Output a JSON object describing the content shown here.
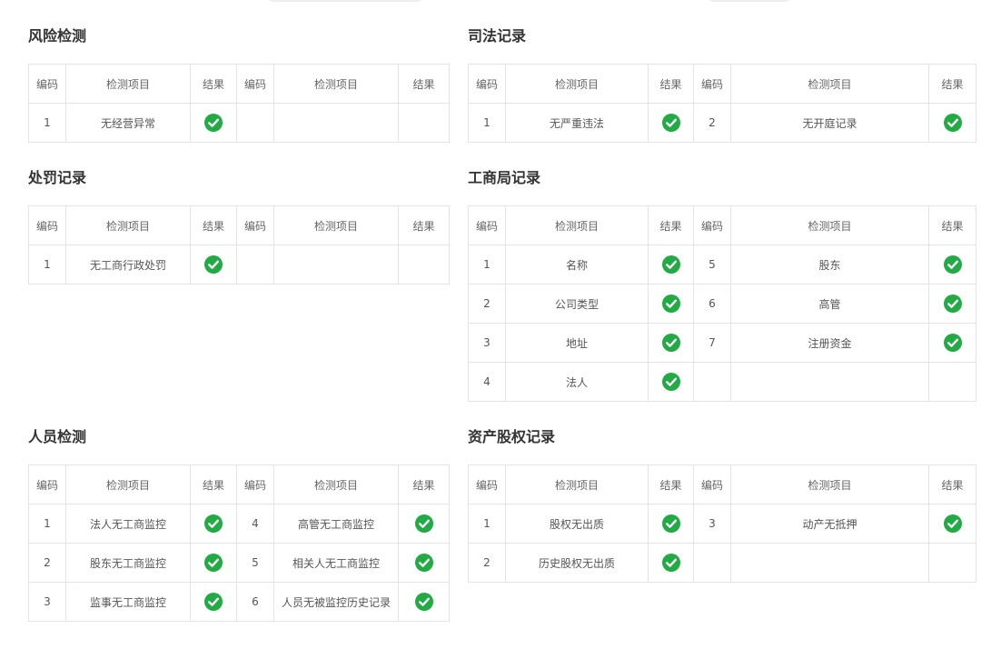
{
  "headers": {
    "code": "编码",
    "item": "检测项目",
    "result": "结果"
  },
  "colors": {
    "check": "#22aa44",
    "border": "#e4e4e4"
  },
  "icons": {
    "pass": "check-circle-icon"
  },
  "sections": [
    {
      "key": "risk",
      "title": "风险检测",
      "rows": [
        {
          "left": {
            "code": "1",
            "item": "无经营异常",
            "pass": true
          },
          "right": null
        }
      ]
    },
    {
      "key": "judicial",
      "title": "司法记录",
      "rows": [
        {
          "left": {
            "code": "1",
            "item": "无严重违法",
            "pass": true
          },
          "right": {
            "code": "2",
            "item": "无开庭记录",
            "pass": true
          }
        }
      ]
    },
    {
      "key": "penalty",
      "title": "处罚记录",
      "rows": [
        {
          "left": {
            "code": "1",
            "item": "无工商行政处罚",
            "pass": true
          },
          "right": null
        }
      ]
    },
    {
      "key": "business",
      "title": "工商局记录",
      "rows": [
        {
          "left": {
            "code": "1",
            "item": "名称",
            "pass": true
          },
          "right": {
            "code": "5",
            "item": "股东",
            "pass": true
          }
        },
        {
          "left": {
            "code": "2",
            "item": "公司类型",
            "pass": true
          },
          "right": {
            "code": "6",
            "item": "高管",
            "pass": true
          }
        },
        {
          "left": {
            "code": "3",
            "item": "地址",
            "pass": true
          },
          "right": {
            "code": "7",
            "item": "注册资金",
            "pass": true
          }
        },
        {
          "left": {
            "code": "4",
            "item": "法人",
            "pass": true
          },
          "right": null
        }
      ]
    },
    {
      "key": "personnel",
      "title": "人员检测",
      "rows": [
        {
          "left": {
            "code": "1",
            "item": "法人无工商监控",
            "pass": true
          },
          "right": {
            "code": "4",
            "item": "高管无工商监控",
            "pass": true
          }
        },
        {
          "left": {
            "code": "2",
            "item": "股东无工商监控",
            "pass": true
          },
          "right": {
            "code": "5",
            "item": "相关人无工商监控",
            "pass": true
          }
        },
        {
          "left": {
            "code": "3",
            "item": "监事无工商监控",
            "pass": true
          },
          "right": {
            "code": "6",
            "item": "人员无被监控历史记录",
            "pass": true
          }
        }
      ]
    },
    {
      "key": "equity",
      "title": "资产股权记录",
      "rows": [
        {
          "left": {
            "code": "1",
            "item": "股权无出质",
            "pass": true
          },
          "right": {
            "code": "3",
            "item": "动产无抵押",
            "pass": true
          }
        },
        {
          "left": {
            "code": "2",
            "item": "历史股权无出质",
            "pass": true
          },
          "right": null
        }
      ]
    }
  ]
}
